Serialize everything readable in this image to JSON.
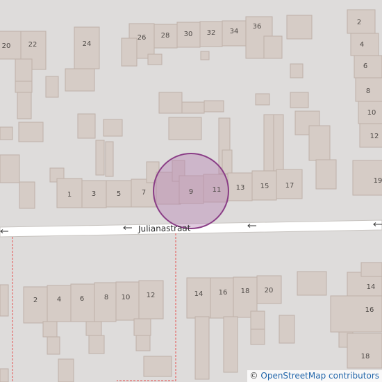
{
  "street": {
    "name": "Julianastraat"
  },
  "marker": {
    "fill": "#b580b2",
    "stroke": "#8a3d86"
  },
  "colors": {
    "background": "#dedcdb",
    "building": "#d6ccc6",
    "road": "#ffffff",
    "boundary": "#e46a6a"
  },
  "attribution": {
    "copyright": "©",
    "text": "OpenStreetMap contributors"
  },
  "house_numbers": {
    "n20": "20",
    "n22": "22",
    "n24": "24",
    "n26": "26",
    "n28": "28",
    "n30": "30",
    "n32": "32",
    "n34": "34",
    "n36": "36",
    "n1": "1",
    "n3": "3",
    "n5": "5",
    "n7": "7",
    "n9": "9",
    "n11": "11",
    "n13": "13",
    "n15": "15",
    "n17": "17",
    "e2": "2",
    "e4": "4",
    "e6": "6",
    "e8": "8",
    "e10": "10",
    "e12": "12",
    "e19": "19",
    "s2": "2",
    "s4": "4",
    "s6": "6",
    "s8": "8",
    "s10": "10",
    "s12": "12",
    "s14": "14",
    "s16": "16",
    "s18": "18",
    "s20": "20",
    "se14": "14",
    "se16": "16",
    "se18": "18"
  }
}
